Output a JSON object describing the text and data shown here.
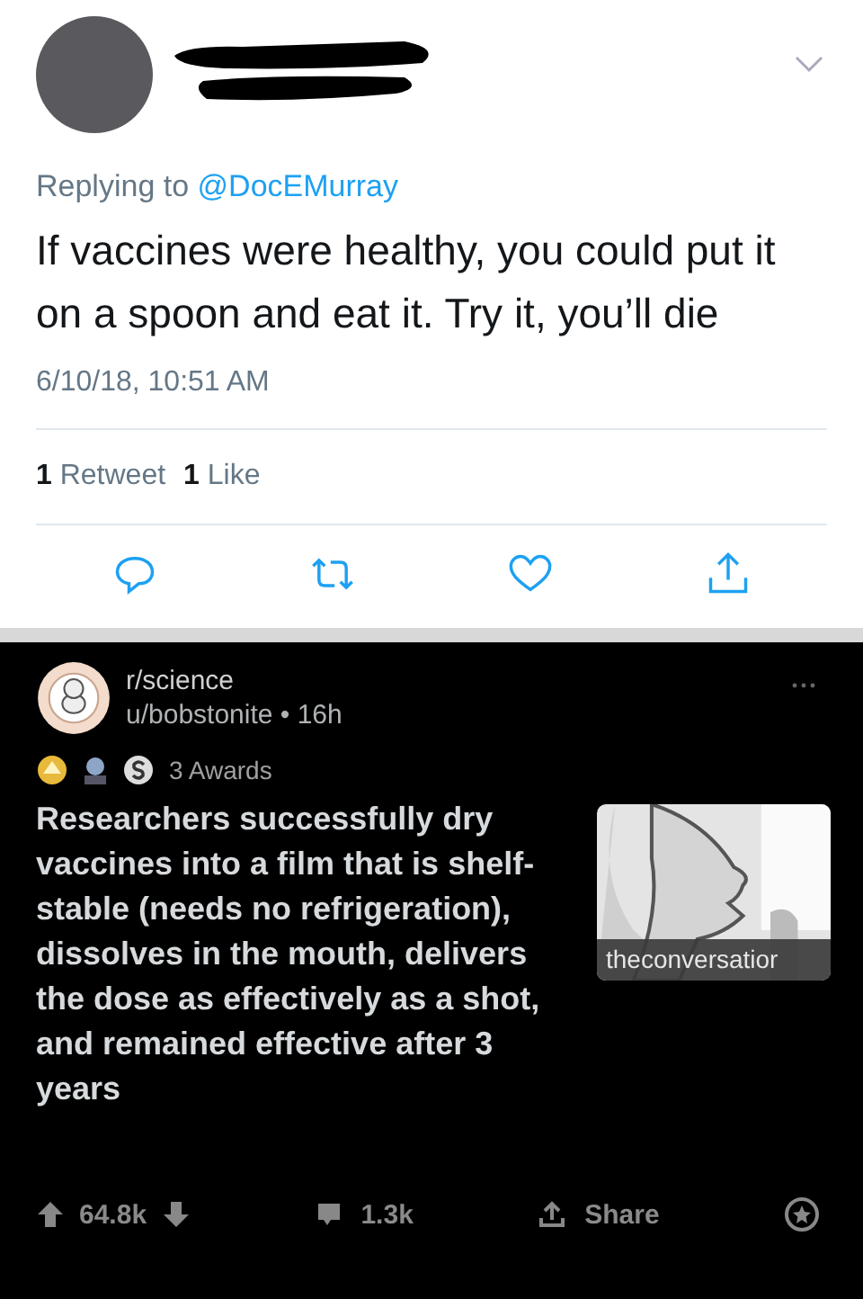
{
  "tweet": {
    "replying_label": "Replying to",
    "reply_to": "@DocEMurray",
    "text": "If vaccines were healthy, you could put it on a spoon and eat it. Try it, you’ll die",
    "timestamp": "6/10/18, 10:51 AM",
    "stats": [
      {
        "count": "1",
        "label": "Retweet"
      },
      {
        "count": "1",
        "label": "Like"
      }
    ],
    "actions": [
      {
        "kind": "reply"
      },
      {
        "kind": "retweet"
      },
      {
        "kind": "like"
      },
      {
        "kind": "share"
      }
    ]
  },
  "reddit_post": {
    "subreddit": "r/science",
    "author": "u/bobstonite",
    "separator": "•",
    "age": "16h",
    "awards": [
      {
        "kind": "gold"
      },
      {
        "kind": "helpful"
      },
      {
        "kind": "silver"
      }
    ],
    "awards_label": "3 Awards",
    "title": "Researchers successfully dry vaccines into a film that is shelf-stable (needs no refrigeration), dissolves in the mouth, delivers the dose as effectively as a shot, and remained effective after 3 years",
    "link_thumbnail": {
      "kind": "picture",
      "domain": "theconversatior"
    },
    "score": "64.8k",
    "comments": "1.3k",
    "share_label": "Share"
  }
}
